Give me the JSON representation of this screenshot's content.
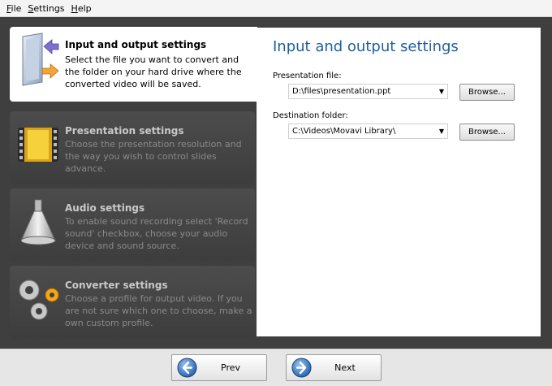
{
  "menu": {
    "file": {
      "accel": "F",
      "rest": "ile"
    },
    "settings": {
      "accel": "S",
      "rest": "ettings"
    },
    "help": {
      "accel": "H",
      "rest": "elp"
    }
  },
  "steps": [
    {
      "title": "Input and output settings",
      "desc": "Select the file you want to convert and the folder on your hard drive where the converted video will be saved.",
      "icon": "folder-arrows-icon",
      "active": true
    },
    {
      "title": "Presentation settings",
      "desc": "Choose the presentation resolution and the way you wish to control slides advance.",
      "icon": "film-strip-icon",
      "active": false
    },
    {
      "title": "Audio settings",
      "desc": "To enable sound recording select 'Record sound' checkbox, choose your audio device and sound source.",
      "icon": "megaphone-icon",
      "active": false
    },
    {
      "title": "Converter settings",
      "desc": "Choose a profile for output video. If you are not sure which one to choose, make a own custom profile.",
      "icon": "gears-icon",
      "active": false
    }
  ],
  "panel": {
    "title": "Input and output settings",
    "presentation_label": "Presentation file:",
    "presentation_value": "D:\\files\\presentation.ppt",
    "destination_label": "Destination folder:",
    "destination_value": "C:\\Videos\\Movavi Library\\",
    "browse_label": "Browse..."
  },
  "footer": {
    "prev_label": "Prev",
    "next_label": "Next"
  },
  "colors": {
    "accent": "#1e5f9e",
    "frame": "#3f3f3f"
  }
}
